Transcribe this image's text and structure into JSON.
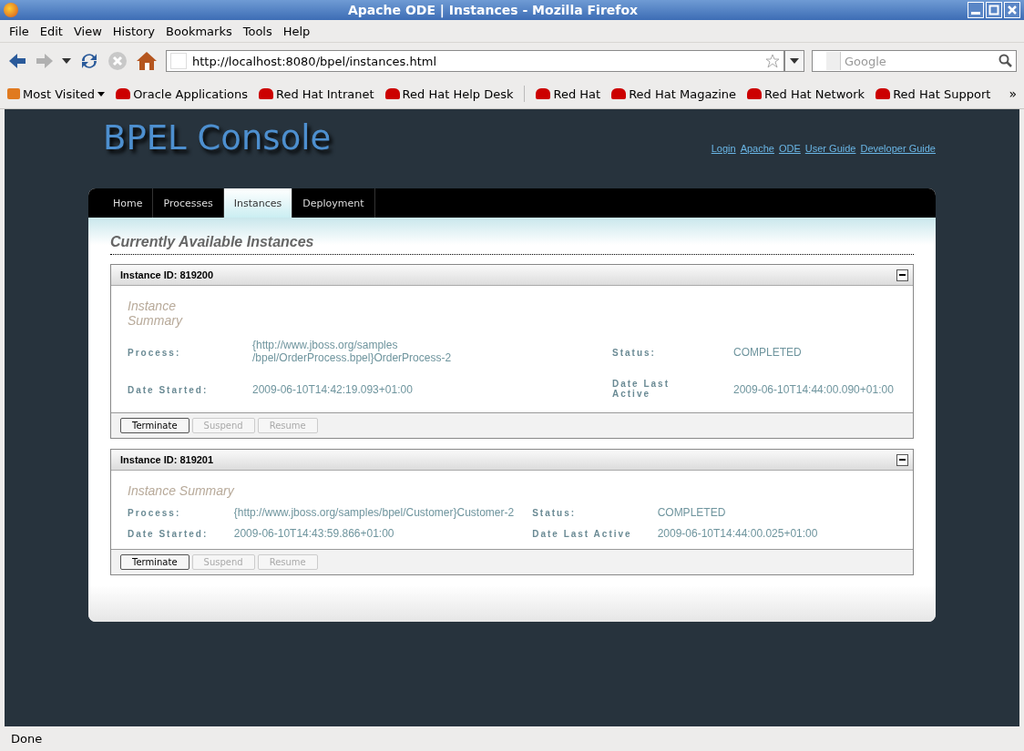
{
  "window": {
    "title": "Apache ODE | Instances - Mozilla Firefox"
  },
  "menu": [
    "File",
    "Edit",
    "View",
    "History",
    "Bookmarks",
    "Tools",
    "Help"
  ],
  "address": {
    "value": "http://localhost:8080/bpel/instances.html"
  },
  "search": {
    "placeholder": "Google"
  },
  "bookmarks": [
    {
      "label": "Most Visited",
      "kind": "folder"
    },
    {
      "label": "Oracle Applications",
      "kind": "link"
    },
    {
      "label": "Red Hat Intranet",
      "kind": "link"
    },
    {
      "label": "Red Hat Help Desk",
      "kind": "link"
    },
    {
      "label": "Red Hat",
      "kind": "link"
    },
    {
      "label": "Red Hat Magazine",
      "kind": "link"
    },
    {
      "label": "Red Hat Network",
      "kind": "link"
    },
    {
      "label": "Red Hat Support",
      "kind": "link"
    }
  ],
  "overflow": "»",
  "page": {
    "logo": "BPEL Console",
    "links": [
      "Login",
      "Apache",
      "ODE",
      "User Guide",
      "Developer Guide"
    ],
    "tabs": [
      {
        "label": "Home",
        "selected": false
      },
      {
        "label": "Processes",
        "selected": false
      },
      {
        "label": "Instances",
        "selected": true
      },
      {
        "label": "Deployment",
        "selected": false
      }
    ],
    "heading": "Currently Available Instances",
    "instances": [
      {
        "title": "Instance ID: 819200",
        "kind": "full",
        "summary": "Instance Summary",
        "process_label": "Process:",
        "process": "{http://www.jboss.org/samples\n/bpel/OrderProcess.bpel}OrderProcess-2",
        "status_label": "Status:",
        "status": "COMPLETED",
        "started_label": "Date Started:",
        "started": "2009-06-10T14:42:19.093+01:00",
        "last_label": "Date Last Active",
        "last": "2009-06-10T14:44:00.090+01:00",
        "buttons": [
          {
            "label": "Terminate",
            "disabled": false
          },
          {
            "label": "Suspend",
            "disabled": true
          },
          {
            "label": "Resume",
            "disabled": true
          }
        ]
      },
      {
        "title": "Instance ID: 819201",
        "kind": "auto",
        "summary": "Instance Summary",
        "process_label": "Process:",
        "process": "{http://www.jboss.org/samples/bpel/Customer}Customer-2",
        "status_label": "Status:",
        "status": "COMPLETED",
        "started_label": "Date Started:",
        "started": "2009-06-10T14:43:59.866+01:00",
        "last_label": "Date Last Active",
        "last": "2009-06-10T14:44:00.025+01:00",
        "buttons": [
          {
            "label": "Terminate",
            "disabled": false
          },
          {
            "label": "Suspend",
            "disabled": true
          },
          {
            "label": "Resume",
            "disabled": true
          }
        ]
      }
    ]
  },
  "status_bar": {
    "text": "Done"
  }
}
